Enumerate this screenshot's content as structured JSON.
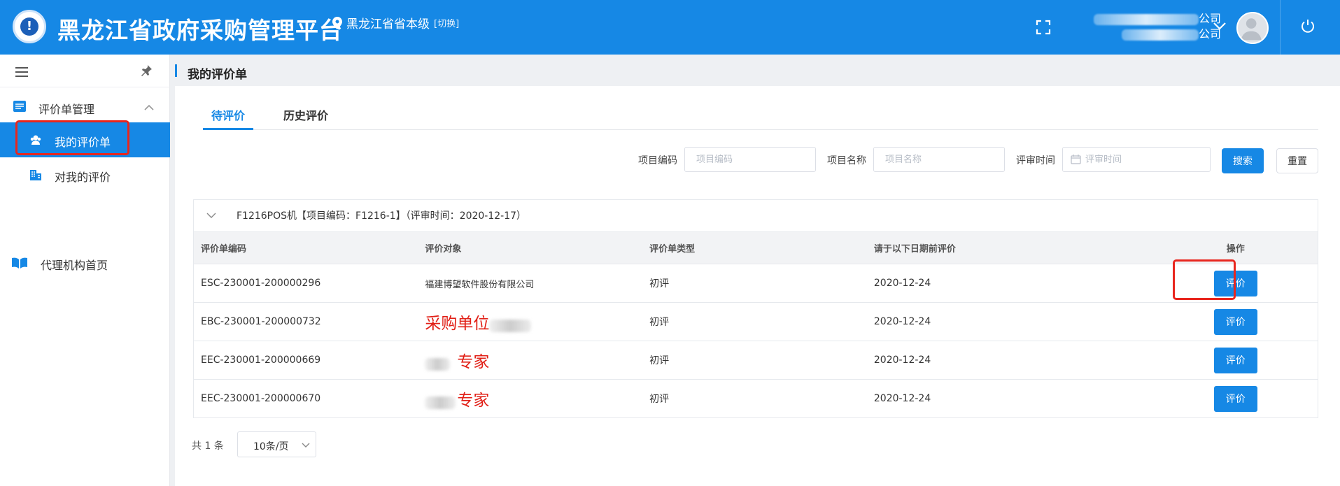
{
  "header": {
    "title": "黑龙江省政府采购管理平台",
    "region": "黑龙江省省本级",
    "region_switch": "[切换]",
    "company_line1": "公司",
    "company_line2": "公司",
    "icons": [
      "fullscreen-icon",
      "chevron-down-icon",
      "avatar",
      "power-icon"
    ]
  },
  "sidebar": {
    "group_label": "评价单管理",
    "items": [
      {
        "label": "我的评价单",
        "active": true
      },
      {
        "label": "对我的评价",
        "active": false
      }
    ],
    "root_item": "代理机构首页"
  },
  "breadcrumb": "我的评价单",
  "tabs": [
    {
      "label": "待评价",
      "active": true
    },
    {
      "label": "历史评价",
      "active": false
    }
  ],
  "filters": {
    "project_code_label": "项目编码",
    "project_code_placeholder": "项目编码",
    "project_name_label": "项目名称",
    "project_name_placeholder": "项目名称",
    "review_time_label": "评审时间",
    "review_time_placeholder": "评审时间",
    "search_label": "搜索",
    "reset_label": "重置"
  },
  "group": {
    "title": "F1216POS机【项目编码：F1216-1】（评审时间：2020-12-17）"
  },
  "table": {
    "columns": [
      "评价单编码",
      "评价对象",
      "评价单类型",
      "请于以下日期前评价",
      "操作"
    ],
    "rows": [
      {
        "code": "ESC-230001-200000296",
        "target": "福建博望软件股份有限公司",
        "type": "初评",
        "deadline": "2020-12-24",
        "action": "评价"
      },
      {
        "code": "EBC-230001-200000732",
        "target": "采购单位",
        "type": "初评",
        "deadline": "2020-12-24",
        "action": "评价"
      },
      {
        "code": "EEC-230001-200000669",
        "target": "专家",
        "type": "初评",
        "deadline": "2020-12-24",
        "action": "评价"
      },
      {
        "code": "EEC-230001-200000670",
        "target": "专家",
        "type": "初评",
        "deadline": "2020-12-24",
        "action": "评价"
      }
    ]
  },
  "pagination": {
    "total": "共 1 条",
    "page_size": "10条/页"
  },
  "colors": {
    "primary": "#1688e5",
    "annotation_red": "#e11f16"
  }
}
